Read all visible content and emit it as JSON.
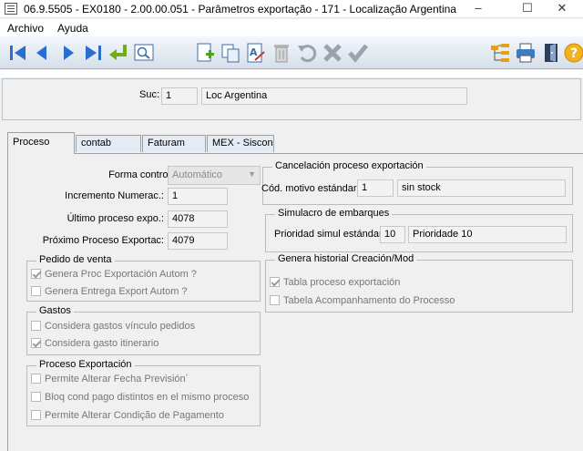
{
  "window": {
    "title": "06.9.5505 - EX0180 - 2.00.00.051 - Parâmetros exportação - 171 - Localização Argentina",
    "minimize_glyph": "–",
    "maximize_glyph": "☐",
    "close_glyph": "✕"
  },
  "menu": {
    "items": [
      "Archivo",
      "Ayuda"
    ]
  },
  "toolbar": {
    "icons": [
      "first-icon",
      "previous-icon",
      "next-icon",
      "last-icon",
      "goto-icon",
      "search-icon",
      "add-icon",
      "copy-icon",
      "edit-icon",
      "delete-icon",
      "undo-icon",
      "cancel-icon",
      "confirm-icon",
      "tree-icon",
      "print-icon",
      "exit-icon",
      "help-icon"
    ]
  },
  "header": {
    "suc_label": "Suc:",
    "suc_code": "1",
    "suc_name": "Loc Argentina"
  },
  "tabs": [
    "Proceso",
    "contab",
    "Faturam",
    "MEX - Siscon"
  ],
  "proceso": {
    "forma_control_label": "Forma control:",
    "forma_control_value": "Automático",
    "incremento_label": "Incremento Numerac.:",
    "incremento_value": "1",
    "ultimo_label": "Último proceso expo.:",
    "ultimo_value": "4078",
    "proximo_label": "Próximo Proceso Exportac:",
    "proximo_value": "4079",
    "pedido_group": {
      "title": "Pedido de venta",
      "items": [
        {
          "label": "Genera Proc Exportación Autom ?",
          "checked": true
        },
        {
          "label": "Genera Entrega Export Autom ?",
          "checked": false
        }
      ]
    },
    "gastos_group": {
      "title": "Gastos",
      "items": [
        {
          "label": "Considera gastos vínculo pedidos",
          "checked": false
        },
        {
          "label": "Considera gasto itinerario",
          "checked": true
        }
      ]
    },
    "proceso_exp_group": {
      "title": "Proceso Exportación",
      "items": [
        {
          "label": "Permite Alterar Fecha Previsión´",
          "checked": false
        },
        {
          "label": "Bloq cond pago distintos en el mismo proceso",
          "checked": false
        },
        {
          "label": "Permite Alterar Condição de Pagamento",
          "checked": false
        }
      ]
    },
    "cancelacion_group": {
      "title": "Cancelación proceso exportación",
      "cod_label": "Cód. motivo estándar:",
      "cod_value": "1",
      "cod_desc": "sin stock"
    },
    "simulacro_group": {
      "title": "Simulacro de embarques",
      "prio_label": "Prioridad simul estándar:",
      "prio_value": "10",
      "prio_desc": "Prioridade 10"
    },
    "historial_group": {
      "title": "Genera historial Creación/Mod",
      "items": [
        {
          "label": "Tabla proceso exportación",
          "checked": true
        },
        {
          "label": "Tabela Acompanhamento do Processo",
          "checked": false
        }
      ]
    }
  }
}
